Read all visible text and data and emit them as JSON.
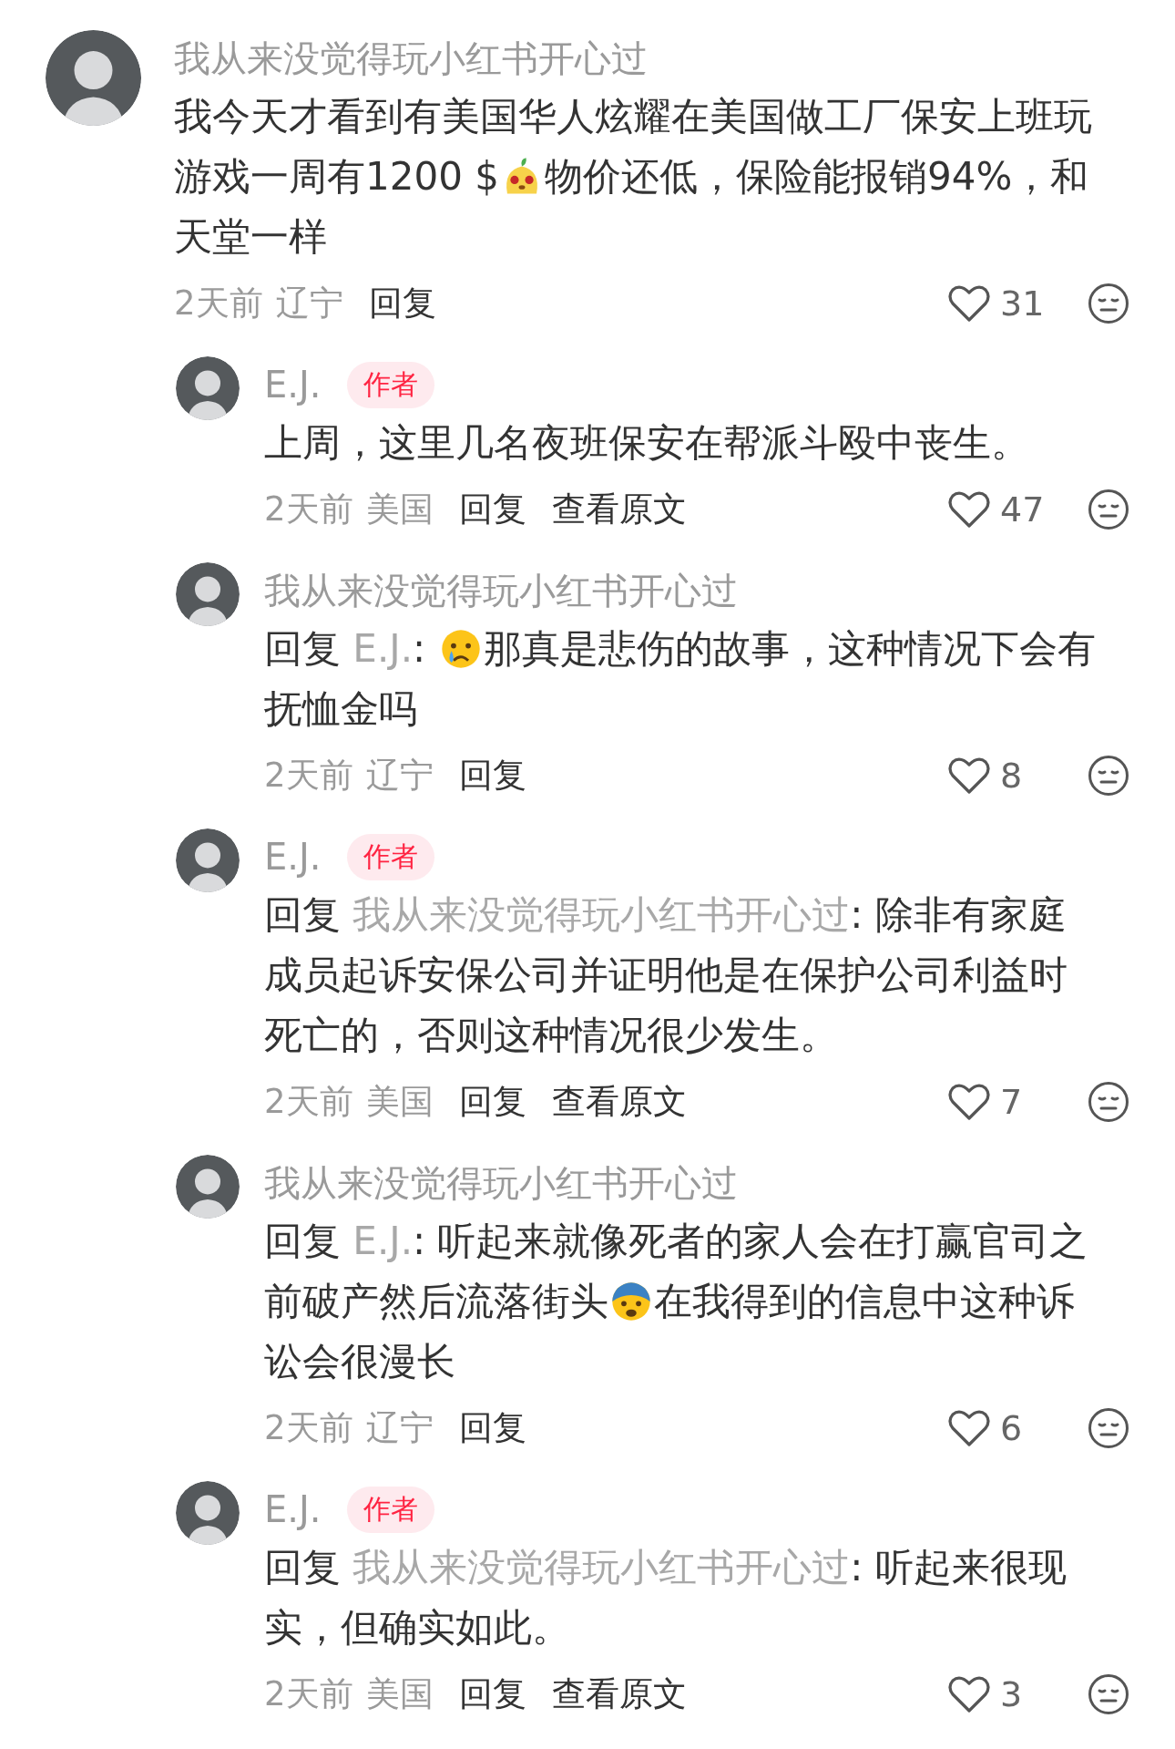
{
  "comments": [
    {
      "user": "我从来没觉得玩小红书开心过",
      "body": [
        {
          "kind": "text",
          "text": "我今天才看到有美国华人炫耀在美国做工厂保安上班玩游戏一周有1200 $"
        },
        {
          "kind": "sticker"
        },
        {
          "kind": "text",
          "text": "物价还低，保险能报销94%，和天堂一样"
        }
      ],
      "time": "2天前",
      "region": "辽宁",
      "actions": [
        "回复"
      ],
      "likes": "31",
      "replies": [
        {
          "user": "E.J.",
          "badge": "作者",
          "body": [
            {
              "kind": "text",
              "text": "上周，这里几名夜班保安在帮派斗殴中丧生。"
            }
          ],
          "time": "2天前",
          "region": "美国",
          "actions": [
            "回复",
            "查看原文"
          ],
          "likes": "47"
        },
        {
          "user": "我从来没觉得玩小红书开心过",
          "reply_label": "回复",
          "reply_to": "E.J.",
          "body": [
            {
              "kind": "text",
              "text": ": "
            },
            {
              "kind": "crying"
            },
            {
              "kind": "text",
              "text": "那真是悲伤的故事，这种情况下会有抚恤金吗"
            }
          ],
          "time": "2天前",
          "region": "辽宁",
          "actions": [
            "回复"
          ],
          "likes": "8"
        },
        {
          "user": "E.J.",
          "badge": "作者",
          "reply_label": "回复",
          "reply_to": "我从来没觉得玩小红书开心过",
          "body": [
            {
              "kind": "text",
              "text": ": 除非有家庭成员起诉安保公司并证明他是在保护公司利益时死亡的，否则这种情况很少发生。"
            }
          ],
          "time": "2天前",
          "region": "美国",
          "actions": [
            "回复",
            "查看原文"
          ],
          "likes": "7"
        },
        {
          "user": "我从来没觉得玩小红书开心过",
          "reply_label": "回复",
          "reply_to": "E.J.",
          "body": [
            {
              "kind": "text",
              "text": ": 听起来就像死者的家人会在打赢官司之前破产然后流落街头"
            },
            {
              "kind": "fearful"
            },
            {
              "kind": "text",
              "text": "在我得到的信息中这种诉讼会很漫长"
            }
          ],
          "time": "2天前",
          "region": "辽宁",
          "actions": [
            "回复"
          ],
          "likes": "6"
        },
        {
          "user": "E.J.",
          "badge": "作者",
          "reply_label": "回复",
          "reply_to": "我从来没觉得玩小红书开心过",
          "body": [
            {
              "kind": "text",
              "text": ": 听起来很现实，但确实如此。"
            }
          ],
          "time": "2天前",
          "region": "美国",
          "actions": [
            "回复",
            "查看原文"
          ],
          "likes": "3"
        }
      ]
    }
  ]
}
